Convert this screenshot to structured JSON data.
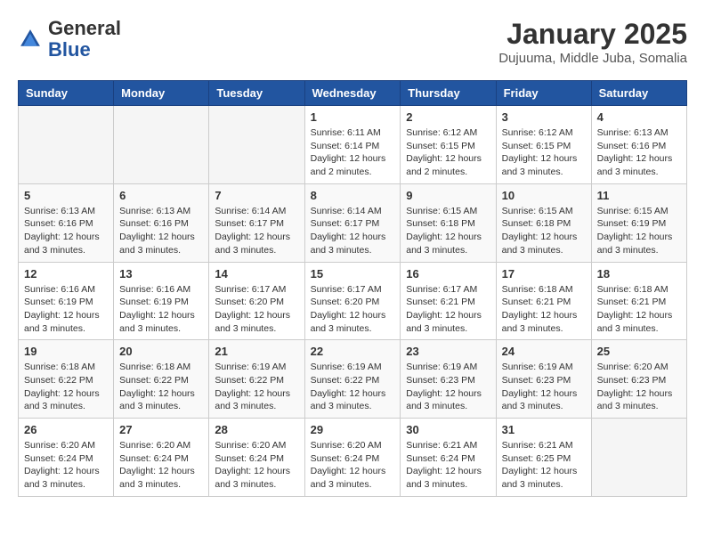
{
  "header": {
    "logo_general": "General",
    "logo_blue": "Blue",
    "month_title": "January 2025",
    "subtitle": "Dujuuma, Middle Juba, Somalia"
  },
  "weekdays": [
    "Sunday",
    "Monday",
    "Tuesday",
    "Wednesday",
    "Thursday",
    "Friday",
    "Saturday"
  ],
  "weeks": [
    [
      {
        "day": "",
        "info": ""
      },
      {
        "day": "",
        "info": ""
      },
      {
        "day": "",
        "info": ""
      },
      {
        "day": "1",
        "info": "Sunrise: 6:11 AM\nSunset: 6:14 PM\nDaylight: 12 hours\nand 2 minutes."
      },
      {
        "day": "2",
        "info": "Sunrise: 6:12 AM\nSunset: 6:15 PM\nDaylight: 12 hours\nand 2 minutes."
      },
      {
        "day": "3",
        "info": "Sunrise: 6:12 AM\nSunset: 6:15 PM\nDaylight: 12 hours\nand 3 minutes."
      },
      {
        "day": "4",
        "info": "Sunrise: 6:13 AM\nSunset: 6:16 PM\nDaylight: 12 hours\nand 3 minutes."
      }
    ],
    [
      {
        "day": "5",
        "info": "Sunrise: 6:13 AM\nSunset: 6:16 PM\nDaylight: 12 hours\nand 3 minutes."
      },
      {
        "day": "6",
        "info": "Sunrise: 6:13 AM\nSunset: 6:16 PM\nDaylight: 12 hours\nand 3 minutes."
      },
      {
        "day": "7",
        "info": "Sunrise: 6:14 AM\nSunset: 6:17 PM\nDaylight: 12 hours\nand 3 minutes."
      },
      {
        "day": "8",
        "info": "Sunrise: 6:14 AM\nSunset: 6:17 PM\nDaylight: 12 hours\nand 3 minutes."
      },
      {
        "day": "9",
        "info": "Sunrise: 6:15 AM\nSunset: 6:18 PM\nDaylight: 12 hours\nand 3 minutes."
      },
      {
        "day": "10",
        "info": "Sunrise: 6:15 AM\nSunset: 6:18 PM\nDaylight: 12 hours\nand 3 minutes."
      },
      {
        "day": "11",
        "info": "Sunrise: 6:15 AM\nSunset: 6:19 PM\nDaylight: 12 hours\nand 3 minutes."
      }
    ],
    [
      {
        "day": "12",
        "info": "Sunrise: 6:16 AM\nSunset: 6:19 PM\nDaylight: 12 hours\nand 3 minutes."
      },
      {
        "day": "13",
        "info": "Sunrise: 6:16 AM\nSunset: 6:19 PM\nDaylight: 12 hours\nand 3 minutes."
      },
      {
        "day": "14",
        "info": "Sunrise: 6:17 AM\nSunset: 6:20 PM\nDaylight: 12 hours\nand 3 minutes."
      },
      {
        "day": "15",
        "info": "Sunrise: 6:17 AM\nSunset: 6:20 PM\nDaylight: 12 hours\nand 3 minutes."
      },
      {
        "day": "16",
        "info": "Sunrise: 6:17 AM\nSunset: 6:21 PM\nDaylight: 12 hours\nand 3 minutes."
      },
      {
        "day": "17",
        "info": "Sunrise: 6:18 AM\nSunset: 6:21 PM\nDaylight: 12 hours\nand 3 minutes."
      },
      {
        "day": "18",
        "info": "Sunrise: 6:18 AM\nSunset: 6:21 PM\nDaylight: 12 hours\nand 3 minutes."
      }
    ],
    [
      {
        "day": "19",
        "info": "Sunrise: 6:18 AM\nSunset: 6:22 PM\nDaylight: 12 hours\nand 3 minutes."
      },
      {
        "day": "20",
        "info": "Sunrise: 6:18 AM\nSunset: 6:22 PM\nDaylight: 12 hours\nand 3 minutes."
      },
      {
        "day": "21",
        "info": "Sunrise: 6:19 AM\nSunset: 6:22 PM\nDaylight: 12 hours\nand 3 minutes."
      },
      {
        "day": "22",
        "info": "Sunrise: 6:19 AM\nSunset: 6:22 PM\nDaylight: 12 hours\nand 3 minutes."
      },
      {
        "day": "23",
        "info": "Sunrise: 6:19 AM\nSunset: 6:23 PM\nDaylight: 12 hours\nand 3 minutes."
      },
      {
        "day": "24",
        "info": "Sunrise: 6:19 AM\nSunset: 6:23 PM\nDaylight: 12 hours\nand 3 minutes."
      },
      {
        "day": "25",
        "info": "Sunrise: 6:20 AM\nSunset: 6:23 PM\nDaylight: 12 hours\nand 3 minutes."
      }
    ],
    [
      {
        "day": "26",
        "info": "Sunrise: 6:20 AM\nSunset: 6:24 PM\nDaylight: 12 hours\nand 3 minutes."
      },
      {
        "day": "27",
        "info": "Sunrise: 6:20 AM\nSunset: 6:24 PM\nDaylight: 12 hours\nand 3 minutes."
      },
      {
        "day": "28",
        "info": "Sunrise: 6:20 AM\nSunset: 6:24 PM\nDaylight: 12 hours\nand 3 minutes."
      },
      {
        "day": "29",
        "info": "Sunrise: 6:20 AM\nSunset: 6:24 PM\nDaylight: 12 hours\nand 3 minutes."
      },
      {
        "day": "30",
        "info": "Sunrise: 6:21 AM\nSunset: 6:24 PM\nDaylight: 12 hours\nand 3 minutes."
      },
      {
        "day": "31",
        "info": "Sunrise: 6:21 AM\nSunset: 6:25 PM\nDaylight: 12 hours\nand 3 minutes."
      },
      {
        "day": "",
        "info": ""
      }
    ]
  ]
}
